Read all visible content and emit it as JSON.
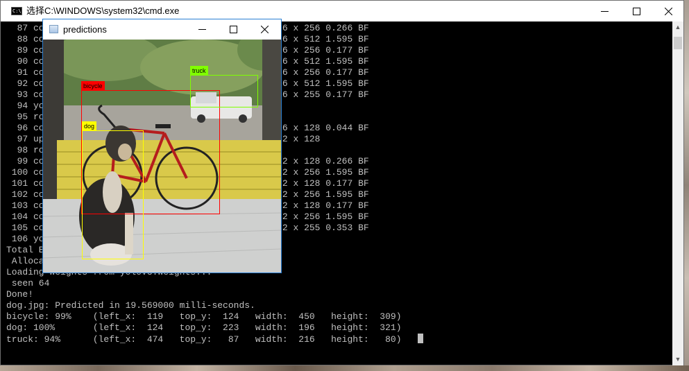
{
  "console_window": {
    "title": "选择C:\\WINDOWS\\system32\\cmd.exe",
    "lines": [
      "  87 co                                     26 x  26 x 256 0.266 BF",
      "  88 co                                     26 x  26 x 512 1.595 BF",
      "  89 co                                     26 x  26 x 256 0.177 BF",
      "  90 co                                     26 x  26 x 512 1.595 BF",
      "  91 co                                     26 x  26 x 256 0.177 BF",
      "  92 co                                     26 x  26 x 512 1.595 BF",
      "  93 co                                     26 x  26 x 255 0.177 BF",
      "  94 yo",
      "  95 ro",
      "  96 co                                     26 x  26 x 128 0.044 BF",
      "  97 up                                     52 x  52 x 128",
      "  98 ro",
      "  99 co                                     52 x  52 x 128 0.266 BF",
      " 100 co                                     52 x  52 x 256 1.595 BF",
      " 101 co                                     52 x  52 x 128 0.177 BF",
      " 102 co                                     52 x  52 x 256 1.595 BF",
      " 103 co                                     52 x  52 x 128 0.177 BF",
      " 104 co                                     52 x  52 x 256 1.595 BF",
      " 105 co                                     52 x  52 x 255 0.353 BF",
      " 106 yo",
      "Total B",
      " Alloca",
      "Loading weights from yolov3.weights...",
      " seen 64",
      "Done!",
      "dog.jpg: Predicted in 19.569000 milli-seconds.",
      "bicycle: 99%    (left_x:  119   top_y:  124   width:  450   height:  309)",
      "dog: 100%       (left_x:  124   top_y:  223   width:  196   height:  321)",
      "truck: 94%      (left_x:  474   top_y:   87   width:  216   height:   80)   "
    ]
  },
  "predictions_window": {
    "title": "predictions",
    "detections": [
      {
        "label": "bicycle",
        "color": "#ff0000"
      },
      {
        "label": "truck",
        "color": "#80ff00"
      },
      {
        "label": "dog",
        "color": "#ffff00"
      }
    ]
  },
  "icons": {
    "minimize": "minimize-icon",
    "maximize": "maximize-icon",
    "close": "close-icon",
    "scroll_up": "scroll-up-arrow-icon",
    "scroll_down": "scroll-down-arrow-icon"
  }
}
